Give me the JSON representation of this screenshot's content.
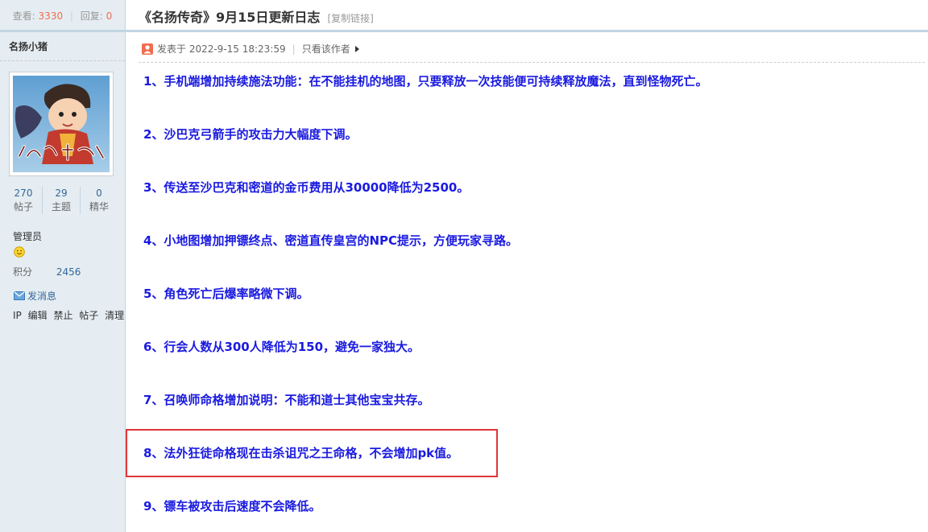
{
  "sidebar": {
    "stats": {
      "views_label": "查看:",
      "views": "3330",
      "replies_label": "回复:",
      "replies": "0"
    },
    "author": "名扬小猪",
    "avatar_text": "小猪出品",
    "counts": [
      {
        "value": "270",
        "label": "帖子"
      },
      {
        "value": "29",
        "label": "主题"
      },
      {
        "value": "0",
        "label": "精华"
      }
    ],
    "role": "管理员",
    "score_label": "积分",
    "score_value": "2456",
    "send_message": "发消息",
    "admin_links": [
      "IP",
      "编辑",
      "禁止",
      "帖子",
      "清理"
    ]
  },
  "post": {
    "title": "《名扬传奇》9月15日更新日志",
    "copy_link": "[复制链接]",
    "posted_at": "发表于 2022-9-15 18:23:59",
    "only_author": "只看该作者",
    "items": [
      "1、手机端增加持续施法功能：在不能挂机的地图，只要释放一次技能便可持续释放魔法，直到怪物死亡。",
      "2、沙巴克弓箭手的攻击力大幅度下调。",
      "3、传送至沙巴克和密道的金币费用从30000降低为2500。",
      "4、小地图增加押镖终点、密道直传皇宫的NPC提示，方便玩家寻路。",
      "5、角色死亡后爆率略微下调。",
      "6、行会人数从300人降低为150，避免一家独大。",
      "7、召唤师命格增加说明：不能和道士其他宝宝共存。",
      "8、法外狂徒命格现在击杀诅咒之王命格，不会增加pk值。",
      "9、镖车被攻击后速度不会降低。"
    ]
  },
  "colors": {
    "item_text": "#1a1ae0",
    "highlight_border": "#e0363a",
    "sidebar_bg": "#e5edf2"
  }
}
